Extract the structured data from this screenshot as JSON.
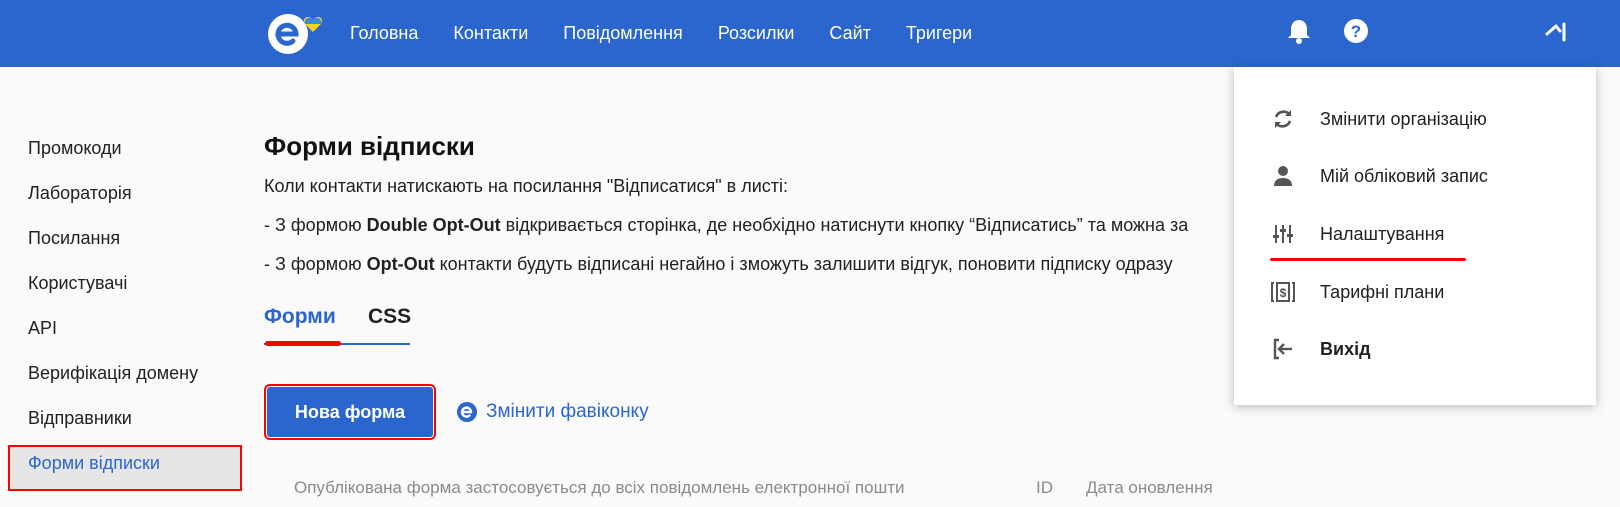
{
  "header": {
    "nav": [
      "Головна",
      "Контакти",
      "Повідомлення",
      "Розсилки",
      "Сайт",
      "Тригери"
    ],
    "brand_color": "#2b66cf"
  },
  "sidebar": {
    "items": [
      {
        "label": "Промокоди"
      },
      {
        "label": "Лабораторія"
      },
      {
        "label": "Посилання"
      },
      {
        "label": "Користувачі"
      },
      {
        "label": "API"
      },
      {
        "label": "Верифікація домену"
      },
      {
        "label": "Відправники"
      },
      {
        "label": "Форми відписки",
        "active": true
      }
    ]
  },
  "main": {
    "title": "Форми відписки",
    "intro": "Коли контакти натискають на посилання \"Відписатися\" в листі:",
    "line1_prefix": "- З формою ",
    "line1_bold": "Double Opt-Out",
    "line1_rest": " відкривається сторінка, де необхідно натиснути кнопку “Відписатись” та можна за",
    "line2_prefix": "- З формою ",
    "line2_bold": "Opt-Out",
    "line2_rest": " контакти будуть відписані негайно і зможуть залишити відгук, поновити підписку одразу",
    "tabs": {
      "forms": "Форми",
      "css": "CSS"
    },
    "new_form_button": "Нова форма",
    "change_favicon": "Змінити фавіконку",
    "table": {
      "col_desc": "Опублікована форма застосовується до всіх повідомлень електронної пошти",
      "col_id": "ID",
      "col_updated": "Дата оновлення"
    }
  },
  "dropdown": {
    "items": [
      {
        "label": "Змінити організацію",
        "icon": "refresh-icon"
      },
      {
        "label": "Мій обліковий запис",
        "icon": "user-icon"
      },
      {
        "label": "Налаштування",
        "icon": "sliders-icon"
      },
      {
        "label": "Тарифні плани",
        "icon": "billing-icon"
      },
      {
        "label": "Вихід",
        "icon": "logout-icon"
      }
    ]
  }
}
